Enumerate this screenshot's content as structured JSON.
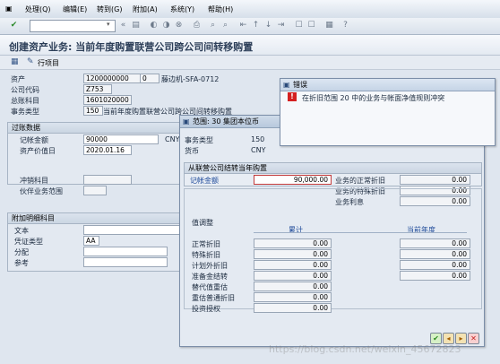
{
  "menubar": {
    "items": [
      "处理(Q)",
      "编辑(E)",
      "转到(G)",
      "附加(A)",
      "系统(Y)",
      "帮助(H)"
    ]
  },
  "toolbar": {
    "command_field_value": ""
  },
  "page": {
    "title": "创建资产业务: 当前年度购置联营公司跨公司间转移购置",
    "app_toolbar_label": "行项目"
  },
  "header": {
    "asset_label": "资产",
    "asset_value": "1200000000",
    "asset_sub": "0",
    "asset_desc": "藤边机-SFA-0712",
    "company_label": "公司代码",
    "company_value": "Z753",
    "gl_label": "总账科目",
    "gl_value": "1601020000",
    "txtype_label": "事务类型",
    "txtype_value": "150",
    "txtype_desc": "当前年度购置联营公司跨公司间转移购置"
  },
  "posting": {
    "section_title": "过账数据",
    "amount_label": "记帐金额",
    "amount_value": "90000",
    "amount_currency": "CNY",
    "value_date_label": "资产价值日",
    "value_date_value": "2020.01.16",
    "offset_label": "冲销科目",
    "tp_label": "伙伴业务范围"
  },
  "additional": {
    "section_title": "附加明细科目",
    "text_label": "文本",
    "doctype_label": "凭证类型",
    "doctype_value": "AA",
    "assignment_label": "分配",
    "reference_label": "参考"
  },
  "error_popup": {
    "title": "错误",
    "message": "在折旧范围 20 中的业务与帐面净值规则冲突"
  },
  "area_popup": {
    "title": "范围: 30 集团本位币",
    "txtype_label": "事务类型",
    "txtype_value": "150",
    "currency_label": "货币",
    "currency_value": "CNY",
    "transfer_section_title": "从联营公司结转当年购置",
    "amount_label": "记帐金额",
    "amount_value": "90,000.00",
    "right_rows": [
      {
        "label": "业务的正常折旧",
        "value": "0.00"
      },
      {
        "label": "业务的特殊折旧",
        "value": "0.00"
      },
      {
        "label": "业务利息",
        "value": "0.00"
      }
    ],
    "adjust_section_title": "值调整",
    "col_cumulative": "累计",
    "col_current_year": "当前年度",
    "adjust_rows": [
      {
        "label": "正常折旧",
        "cumulative": "0.00",
        "current": "0.00"
      },
      {
        "label": "特殊折旧",
        "cumulative": "0.00",
        "current": "0.00"
      },
      {
        "label": "计划外折旧",
        "cumulative": "0.00",
        "current": "0.00"
      },
      {
        "label": "准备金结转",
        "cumulative": "0.00",
        "current": "0.00"
      },
      {
        "label": "替代值重估",
        "cumulative": "0.00",
        "current": ""
      },
      {
        "label": "重估普通折旧",
        "cumulative": "0.00",
        "current": ""
      },
      {
        "label": "投资授权",
        "cumulative": "0.00",
        "current": ""
      }
    ]
  },
  "watermark": "https://blog.csdn.net/weixin_45672823"
}
